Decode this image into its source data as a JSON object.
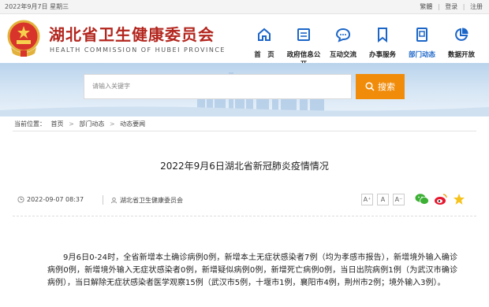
{
  "topbar": {
    "date": "2022年9月7日 星期三",
    "links": [
      "繁體",
      "登录",
      "注册"
    ]
  },
  "header": {
    "title": "湖北省卫生健康委员会",
    "subtitle": "HEALTH COMMISSION OF HUBEI PROVINCE"
  },
  "nav": {
    "items": [
      {
        "label": "首　页",
        "icon": "home-icon"
      },
      {
        "label": "政府信息公开",
        "icon": "document-icon"
      },
      {
        "label": "互动交流",
        "icon": "chat-bubble-icon"
      },
      {
        "label": "办事服务",
        "icon": "bookmark-icon"
      },
      {
        "label": "部门动态",
        "icon": "file-icon",
        "active": true
      },
      {
        "label": "数据开放",
        "icon": "pie-chart-icon"
      }
    ],
    "active_color": "#1c66c8"
  },
  "search": {
    "placeholder": "请输入关键字",
    "button_label": "搜索",
    "button_color": "#f08c0a"
  },
  "breadcrumb": {
    "prefix": "当前位置：",
    "items": [
      "首页",
      "部门动态",
      "动态要闻"
    ]
  },
  "article": {
    "title": "2022年9月6日湖北省新冠肺炎疫情情况",
    "date": "2022-09-07 08:37",
    "source": "湖北省卫生健康委员会",
    "font_sizes": [
      "A⁺",
      "A",
      "A⁻"
    ],
    "body": "9月6日0-24时，全省新增本土确诊病例0例，新增本土无症状感染者7例（均为孝感市报告），新增境外输入确诊病例0例，新增境外输入无症状感染者0例，新增疑似病例0例，新增死亡病例0例，当日出院病例1例（为武汉市确诊病例），当日解除无症状感染者医学观察15例（武汉市5例，十堰市1例，襄阳市4例，荆州市2例；境外输入3例）。"
  },
  "colors": {
    "brand_red": "#b3261e",
    "banner_blue": "#b9d3ec"
  }
}
